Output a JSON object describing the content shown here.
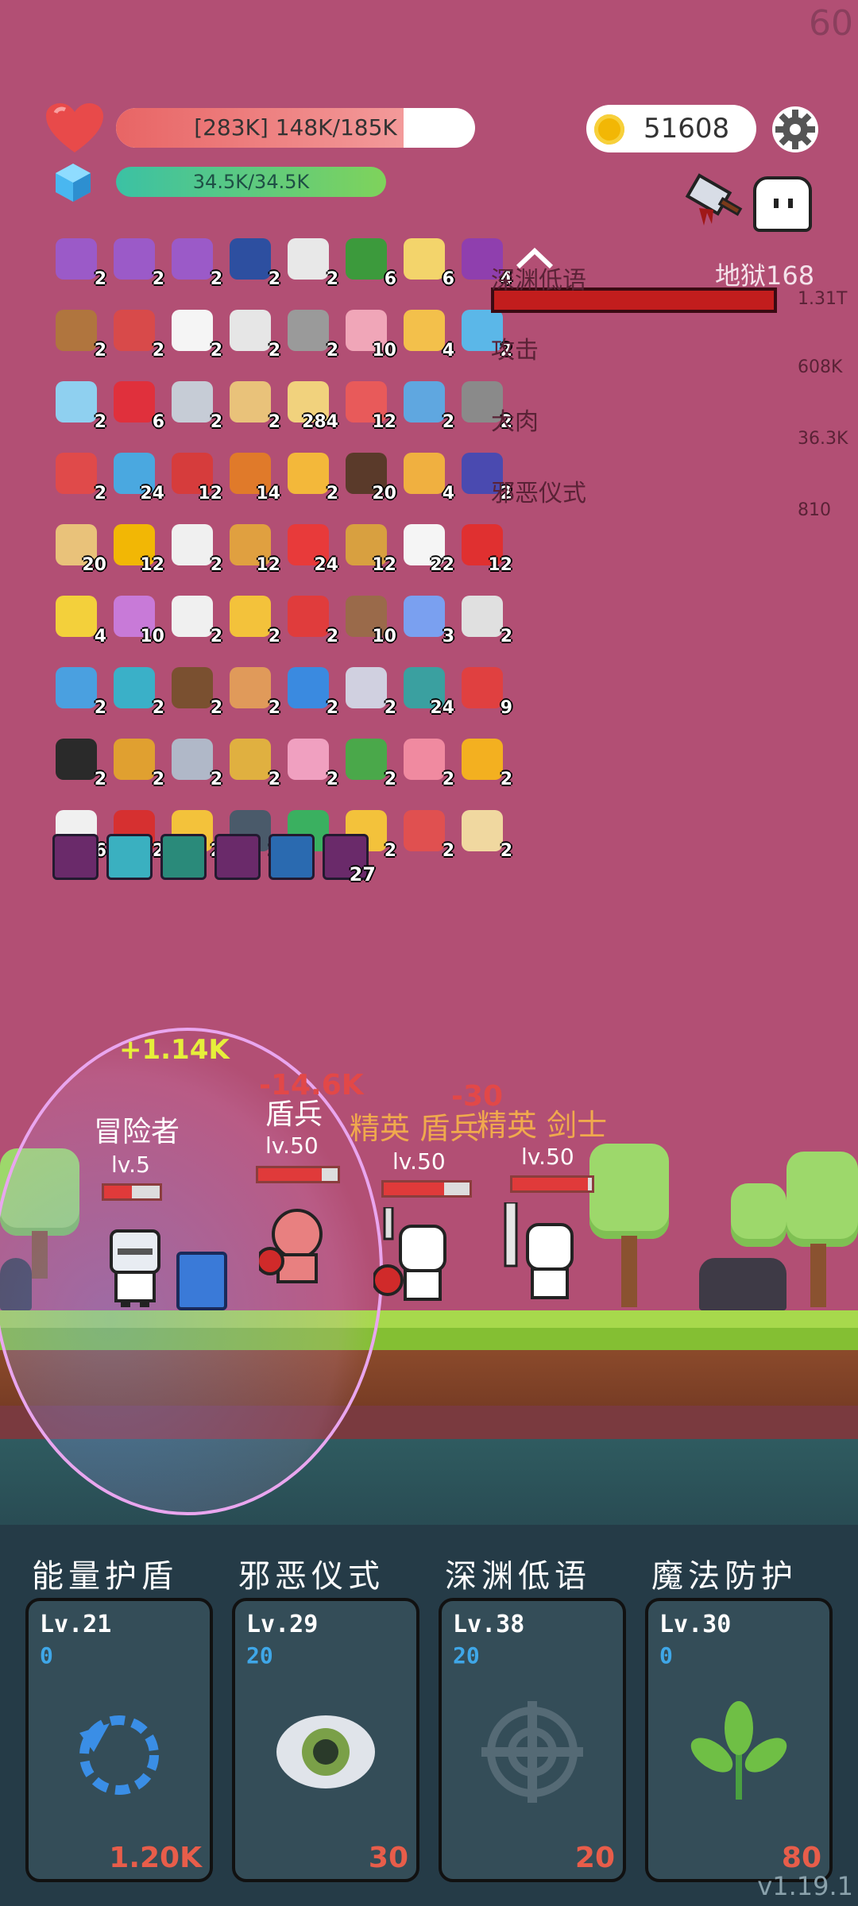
{
  "fps": "60",
  "player": {
    "hp_text": "[283K] 148K/185K",
    "hp_fraction": 0.8,
    "mp_text": "34.5K/34.5K",
    "mp_fraction": 1.0
  },
  "gold": "51608",
  "colors": {
    "hp": "#e86565",
    "mp_start": "#3bc1a4",
    "mp_end": "#7fd35b",
    "boss_bar": "#c21d1d",
    "cost": "#e85d4a",
    "cooldown": "#3fa7e8"
  },
  "inventory": [
    {
      "icon": "scroll-pink-icon",
      "count": "2",
      "color": "#9b5ac8"
    },
    {
      "icon": "scroll-pink-icon",
      "count": "2",
      "color": "#9b5ac8"
    },
    {
      "icon": "scroll-pink-icon",
      "count": "2",
      "color": "#9b5ac8"
    },
    {
      "icon": "bible-icon",
      "count": "2",
      "color": "#2d4fa0"
    },
    {
      "icon": "checklist-icon",
      "count": "2",
      "color": "#e8e8e8"
    },
    {
      "icon": "snake-icon",
      "count": "6",
      "color": "#3c9a3c"
    },
    {
      "icon": "paper-icon",
      "count": "6",
      "color": "#f3d46b"
    },
    {
      "icon": "potion-purple-icon",
      "count": "4",
      "color": "#8f3fae"
    },
    {
      "icon": "drumstick-icon",
      "count": "2",
      "color": "#b0753e"
    },
    {
      "icon": "shield-red-icon",
      "count": "2",
      "color": "#d84a4a"
    },
    {
      "icon": "speech-bubble-icon",
      "count": "2",
      "color": "#f5f5f5"
    },
    {
      "icon": "lightbulb-icon",
      "count": "2",
      "color": "#e6e6e6"
    },
    {
      "icon": "compass-icon",
      "count": "2",
      "color": "#9a9a9a"
    },
    {
      "icon": "calendar-icon",
      "count": "10",
      "color": "#f0a6b8"
    },
    {
      "icon": "letter-icon",
      "count": "4",
      "color": "#f3c04b"
    },
    {
      "icon": "refresh-ring-icon",
      "count": "2",
      "color": "#5bb7e8"
    },
    {
      "icon": "ice-block-icon",
      "count": "2",
      "color": "#8fd0f0"
    },
    {
      "icon": "ruby-icon",
      "count": "6",
      "color": "#e0303c"
    },
    {
      "icon": "swords-icon",
      "count": "2",
      "color": "#c6ccd6"
    },
    {
      "icon": "scroll-map-icon",
      "count": "2",
      "color": "#e9c27a"
    },
    {
      "icon": "book-open-icon",
      "count": "284",
      "color": "#f1d27d"
    },
    {
      "icon": "watermelon-icon",
      "count": "12",
      "color": "#e85a5a"
    },
    {
      "icon": "shirt-icon",
      "count": "2",
      "color": "#5fa7e0"
    },
    {
      "icon": "tombstone-icon",
      "count": "2",
      "color": "#8a8a8a"
    },
    {
      "icon": "thermometer-icon",
      "count": "2",
      "color": "#e04a4a"
    },
    {
      "icon": "globe-bomb-icon",
      "count": "24",
      "color": "#4aa8e0"
    },
    {
      "icon": "sock-icon",
      "count": "12",
      "color": "#d63c3c"
    },
    {
      "icon": "flag-icon",
      "count": "14",
      "color": "#e07a2a"
    },
    {
      "icon": "beer-icon",
      "count": "2",
      "color": "#f3b83a"
    },
    {
      "icon": "pirate-ship-icon",
      "count": "20",
      "color": "#5a3a2a"
    },
    {
      "icon": "crown-outline-icon",
      "count": "4",
      "color": "#f0b040"
    },
    {
      "icon": "wizard-hat-icon",
      "count": "2",
      "color": "#4a4ab0"
    },
    {
      "icon": "treasure-map-icon",
      "count": "20",
      "color": "#e9c27a"
    },
    {
      "icon": "coin-stack-icon",
      "count": "12",
      "color": "#f2b705"
    },
    {
      "icon": "envelope-icon",
      "count": "2",
      "color": "#f0f0f0"
    },
    {
      "icon": "book-gold-icon",
      "count": "12",
      "color": "#e0a040"
    },
    {
      "icon": "heart-icon",
      "count": "24",
      "color": "#e83a3a"
    },
    {
      "icon": "comet-icon",
      "count": "12",
      "color": "#d8a040"
    },
    {
      "icon": "ghost-icon",
      "count": "22",
      "color": "#f5f5f5"
    },
    {
      "icon": "apple-icon",
      "count": "12",
      "color": "#e03030"
    },
    {
      "icon": "sun-icon",
      "count": "4",
      "color": "#f3d03b"
    },
    {
      "icon": "flower-purple-icon",
      "count": "10",
      "color": "#c87ad8"
    },
    {
      "icon": "playing-card-icon",
      "count": "2",
      "color": "#f0f0f0"
    },
    {
      "icon": "crown-icon",
      "count": "2",
      "color": "#f3c23b"
    },
    {
      "icon": "strawberry-icon",
      "count": "2",
      "color": "#e03c3c"
    },
    {
      "icon": "donut-icon",
      "count": "10",
      "color": "#9a6a4a"
    },
    {
      "icon": "pill-icon",
      "count": "3",
      "color": "#7aa0f0"
    },
    {
      "icon": "sliders-icon",
      "count": "2",
      "color": "#e0e0e0"
    },
    {
      "icon": "target-icon",
      "count": "2",
      "color": "#4aa0e0"
    },
    {
      "icon": "spiral-icon",
      "count": "2",
      "color": "#3ab0c8"
    },
    {
      "icon": "coconut-icon",
      "count": "2",
      "color": "#7a5030"
    },
    {
      "icon": "briefcase-icon",
      "count": "2",
      "color": "#e09a5a"
    },
    {
      "icon": "star-card-icon",
      "count": "2",
      "color": "#3a8ae0"
    },
    {
      "icon": "molecule-icon",
      "count": "2",
      "color": "#d0d0e0"
    },
    {
      "icon": "disc-icon",
      "count": "24",
      "color": "#3aa0a0"
    },
    {
      "icon": "capsule-icon",
      "count": "9",
      "color": "#e04040"
    },
    {
      "icon": "cauldron-icon",
      "count": "2",
      "color": "#2a2a2a"
    },
    {
      "icon": "pineapple-icon",
      "count": "2",
      "color": "#e0a030"
    },
    {
      "icon": "sword-icon",
      "count": "2",
      "color": "#b0b8c8"
    },
    {
      "icon": "egg-icon",
      "count": "2",
      "color": "#e0b040"
    },
    {
      "icon": "ice-cream-icon",
      "count": "2",
      "color": "#f0a0c0"
    },
    {
      "icon": "money-icon",
      "count": "2",
      "color": "#4aa84a"
    },
    {
      "icon": "perfume-icon",
      "count": "2",
      "color": "#f08aa0"
    },
    {
      "icon": "sunflower-icon",
      "count": "2",
      "color": "#f3b020"
    },
    {
      "icon": "daisy-icon",
      "count": "6",
      "color": "#f0f0f0"
    },
    {
      "icon": "magnet-icon",
      "count": "2",
      "color": "#d63030"
    },
    {
      "icon": "magic-wand-icon",
      "count": "2",
      "color": "#f3c23b"
    },
    {
      "icon": "mortar-icon",
      "count": "2",
      "color": "#4a5a6a"
    },
    {
      "icon": "tea-cup-icon",
      "count": "2",
      "color": "#3ab060"
    },
    {
      "icon": "ring-icon",
      "count": "2",
      "color": "#f3c23b"
    },
    {
      "icon": "map-pin-icon",
      "count": "2",
      "color": "#e05050"
    },
    {
      "icon": "old-map-icon",
      "count": "2",
      "color": "#f0d8a0"
    }
  ],
  "relics": [
    {
      "icon": "demon-relic-icon",
      "color": "#6a2a6a",
      "count": ""
    },
    {
      "icon": "light-relic-icon",
      "color": "#3ab0c0",
      "count": ""
    },
    {
      "icon": "skull-relic-icon",
      "color": "#2a8a7a",
      "count": ""
    },
    {
      "icon": "demon-relic-icon",
      "color": "#6a2a6a",
      "count": ""
    },
    {
      "icon": "rune-relic-icon",
      "color": "#2a6ab0",
      "count": ""
    },
    {
      "icon": "bunny-relic-icon",
      "color": "#6a2a6a",
      "count": "27"
    }
  ],
  "boss": {
    "name": "地狱168",
    "hp": "1.31T",
    "skills": [
      {
        "name": "深渊低语",
        "value": ""
      },
      {
        "name": "攻击",
        "value": "608K"
      },
      {
        "name": "大肉",
        "value": "36.3K"
      },
      {
        "name": "邪恶仪式",
        "value": "810"
      }
    ]
  },
  "battle": {
    "hero": {
      "name": "冒险者",
      "level": "lv.5"
    },
    "units": [
      {
        "name": "盾兵",
        "level": "lv.50"
      },
      {
        "name": "精英 盾兵",
        "level": "lv.50"
      },
      {
        "name": "精英 剑士",
        "level": "lv.50"
      }
    ],
    "floating": {
      "heal": "+1.14K",
      "damage1": "-14.6K",
      "damage2": "-30"
    }
  },
  "skills": [
    {
      "name": "能量护盾",
      "level": "Lv.21",
      "cooldown": "0",
      "cost": "1.20K",
      "icon": "refresh-icon"
    },
    {
      "name": "邪恶仪式",
      "level": "Lv.29",
      "cooldown": "20",
      "cost": "30",
      "icon": "eye-icon"
    },
    {
      "name": "深渊低语",
      "level": "Lv.38",
      "cooldown": "20",
      "cost": "20",
      "icon": "crosshair-icon"
    },
    {
      "name": "魔法防护",
      "level": "Lv.30",
      "cooldown": "0",
      "cost": "80",
      "icon": "leaf-icon"
    }
  ],
  "version": "v1.19.1"
}
